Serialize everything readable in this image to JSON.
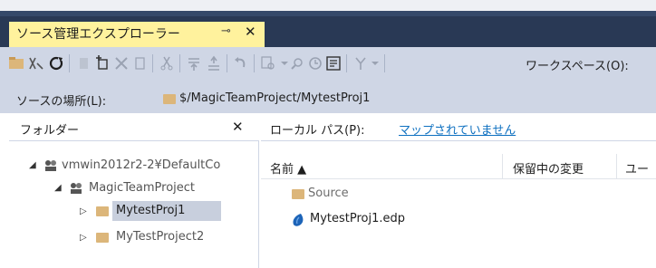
{
  "tab": {
    "title": "ソース管理エクスプローラー",
    "pin": "⊸",
    "close": "✕"
  },
  "toolbar": {
    "workspace_label": "ワークスペース(O):"
  },
  "location": {
    "label": "ソースの場所(L):",
    "path": "$/MagicTeamProject/MytestProj1"
  },
  "folders": {
    "title": "フォルダー",
    "close": "✕",
    "tree": [
      {
        "label": "vmwin2012r2-2¥DefaultCo"
      },
      {
        "label": "MagicTeamProject"
      },
      {
        "label": "MytestProj1"
      },
      {
        "label": "MyTestProject2"
      }
    ]
  },
  "files": {
    "local_path_label": "ローカル パス(P):",
    "local_path_value": "マップされていません",
    "columns": [
      "名前 ▲",
      "保留中の変更",
      "ユー"
    ],
    "rows": [
      {
        "name": "Source"
      },
      {
        "name": "MytestProj1.edp"
      }
    ]
  },
  "colors": {
    "tab_active": "#fff29d",
    "tab_strip": "#293955",
    "toolbar": "#cfd6e5",
    "link": "#0e70c0"
  }
}
